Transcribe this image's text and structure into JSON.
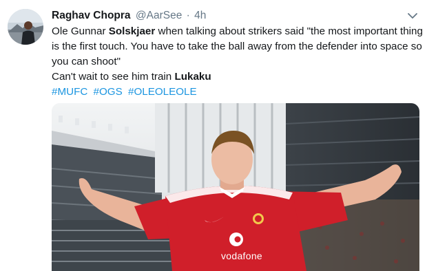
{
  "tweet": {
    "author_name": "Raghav Chopra",
    "author_handle": "@AarSee",
    "separator": "·",
    "time": "4h",
    "line1_pre": "Ole Gunnar ",
    "line1_bold": "Solskjaer",
    "line1_post": " when talking about strikers said \"the most important thing",
    "line2": "is the first touch. You have to take the ball away from the defender into space so",
    "line3": "you can shoot\"",
    "line4_pre": "Can't wait to see him train ",
    "line4_bold": "Lukaku",
    "hashtags": [
      "#MUFC",
      "#OGS",
      "#OLEOLEOLE"
    ]
  },
  "media": {
    "shirt_sponsor": "vodafone"
  },
  "icons": {
    "avatar": "profile-avatar",
    "menu": "chevron-down-icon"
  },
  "colors": {
    "link": "#1b95e0",
    "secondary_text": "#657786",
    "shirt_red": "#d01f2a"
  }
}
